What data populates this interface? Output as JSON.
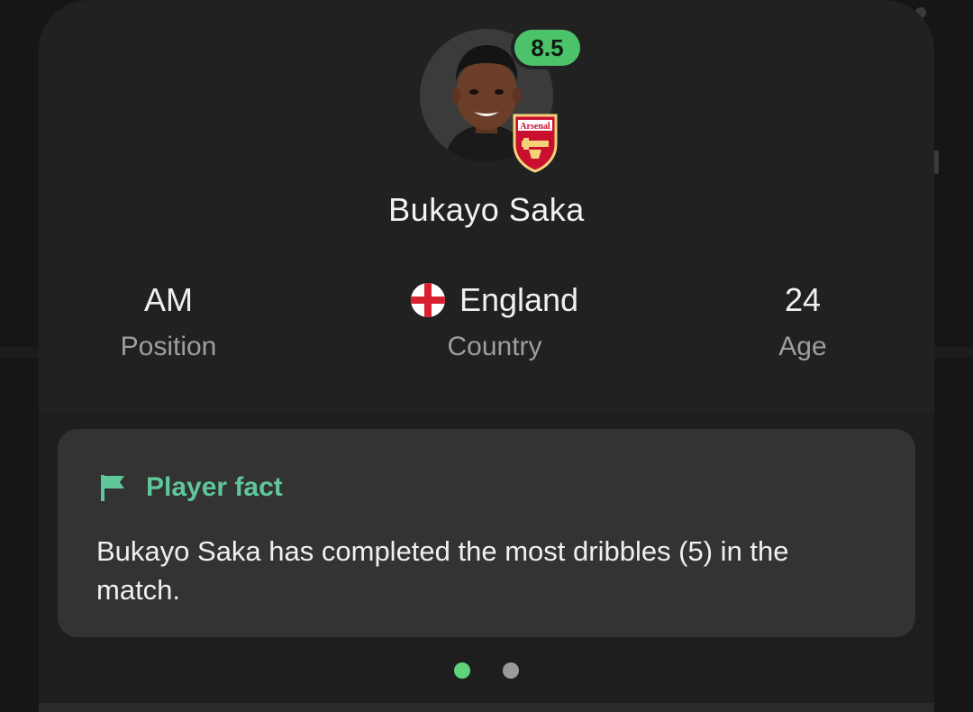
{
  "player": {
    "name": "Bukayo Saka",
    "rating": "8.5",
    "club_badge_text": "Arsenal"
  },
  "stats": [
    {
      "value": "AM",
      "label": "Position"
    },
    {
      "value": "England",
      "label": "Country",
      "flag": "england-flag"
    },
    {
      "value": "24",
      "label": "Age"
    }
  ],
  "fact": {
    "title": "Player fact",
    "icon": "flag-icon",
    "text": "Bukayo Saka has completed the most dribbles (5) in the match."
  },
  "pager": {
    "count": 2,
    "active_index": 0
  },
  "colors": {
    "rating_badge": "#4cc36a",
    "fact_accent": "#5fc79a",
    "pager_active": "#5fd37a",
    "sheet_background": "#212121",
    "card_background": "#333333"
  }
}
